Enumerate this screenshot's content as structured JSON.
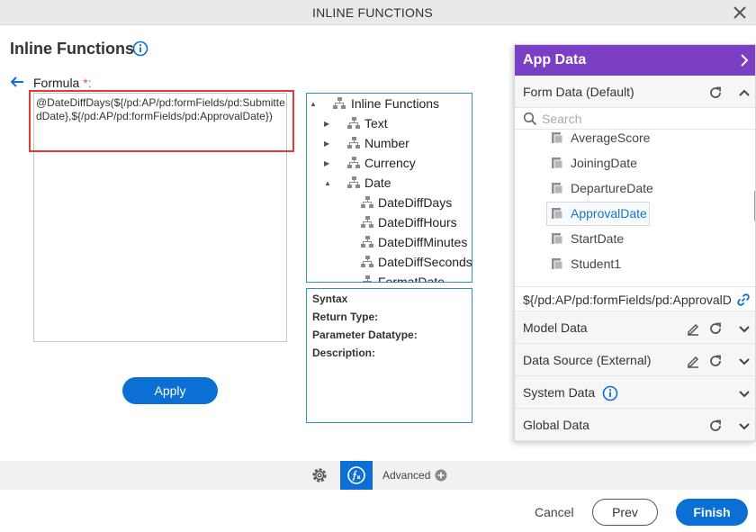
{
  "dialog": {
    "title": "INLINE FUNCTIONS"
  },
  "page": {
    "title": "Inline Functions"
  },
  "formula": {
    "label": "Formula",
    "required_mark": "*:",
    "value": "@DateDiffDays(${/pd:AP/pd:formFields/pd:SubmittedDate},${/pd:AP/pd:formFields/pd:ApprovalDate})"
  },
  "apply_label": "Apply",
  "tree": {
    "items": [
      {
        "label": "Inline Functions",
        "toggle": "▲"
      },
      {
        "label": "Text",
        "toggle": "▶"
      },
      {
        "label": "Number",
        "toggle": "▶"
      },
      {
        "label": "Currency",
        "toggle": "▶"
      },
      {
        "label": "Date",
        "toggle": "▲"
      },
      {
        "label": "DateDiffDays",
        "toggle": ""
      },
      {
        "label": "DateDiffHours",
        "toggle": ""
      },
      {
        "label": "DateDiffMinutes",
        "toggle": ""
      },
      {
        "label": "DateDiffSeconds",
        "toggle": ""
      },
      {
        "label": "FormatDate",
        "toggle": ""
      }
    ]
  },
  "syntax": {
    "syntax": "Syntax",
    "return_type": "Return Type:",
    "parameter_datatype": "Parameter Datatype:",
    "description": "Description:"
  },
  "app_data": {
    "title": "App Data",
    "form_data_label": "Form Data (Default)",
    "search_placeholder": "Search",
    "fields": [
      {
        "label": "AverageScore"
      },
      {
        "label": "JoiningDate"
      },
      {
        "label": "DepartureDate"
      },
      {
        "label": "ApprovalDate"
      },
      {
        "label": "StartDate"
      },
      {
        "label": "Student1"
      }
    ],
    "path_value": "${/pd:AP/pd:formFields/pd:ApprovalDate}",
    "model_data_label": "Model Data",
    "data_source_label": "Data Source (External)",
    "system_data_label": "System Data",
    "global_data_label": "Global Data"
  },
  "bottom": {
    "advanced_label": "Advanced",
    "cancel_label": "Cancel",
    "prev_label": "Prev",
    "finish_label": "Finish"
  },
  "colors": {
    "primary_blue": "#0b6fd4",
    "purple_header": "#7b3fc6",
    "highlight_red": "#e53935",
    "tree_border": "#2f93b3"
  }
}
